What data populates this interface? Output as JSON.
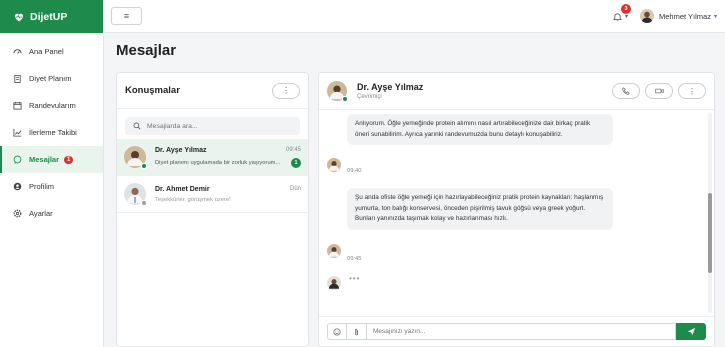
{
  "brand": {
    "name": "DijetUP"
  },
  "sidebar": {
    "items": [
      {
        "label": "Ana Panel",
        "icon": "dashboard-icon"
      },
      {
        "label": "Diyet Planım",
        "icon": "clipboard-icon"
      },
      {
        "label": "Randevularım",
        "icon": "calendar-icon"
      },
      {
        "label": "İlerleme Takibi",
        "icon": "chart-line-icon"
      },
      {
        "label": "Mesajlar",
        "icon": "chat-icon",
        "badge": "1",
        "active": true
      },
      {
        "label": "Profilim",
        "icon": "user-icon"
      },
      {
        "label": "Ayarlar",
        "icon": "gear-icon"
      }
    ]
  },
  "topbar": {
    "menu_icon": "≡",
    "notifications_count": "3",
    "user_name": "Mehmet Yılmaz"
  },
  "page": {
    "title": "Mesajlar"
  },
  "conversations": {
    "title": "Konuşmalar",
    "more_label": "⋮",
    "search_placeholder": "Mesajlarda ara...",
    "items": [
      {
        "name": "Dr. Ayşe Yılmaz",
        "time": "09:45",
        "preview": "Diyet planımı uygulamada bir zorluk yaşıyorum...",
        "unread": "1",
        "online": true
      },
      {
        "name": "Dr. Ahmet Demir",
        "time": "Dün",
        "preview": "Teşekkürler, görüşmek üzere!",
        "online": false
      }
    ]
  },
  "chat": {
    "contact_name": "Dr. Ayşe Yılmaz",
    "contact_status": "Çevrimiçi",
    "messages": [
      {
        "text": "Anlıyorum. Öğle yemeğinde protein alımını nasıl artırabileceğinize dair birkaç pratik öneri sunabilirim. Ayrıca yarınki randevumuzda bunu detaylı konuşabiliriz.",
        "time": "09:40"
      },
      {
        "text": "Şu anda ofiste öğle yemeği için hazırlayabileceğiniz pratik protein kaynakları: haşlanmış yumurta, ton balığı konservesi, önceden pişirilmiş tavuk göğsü veya greek yoğurt. Bunları yanınızda taşımak kolay ve hazırlanması hızlı.",
        "time": "09:45"
      }
    ],
    "typing_indicator": "•••",
    "composer_placeholder": "Mesajınızı yazın...",
    "accent_color": "#1e8a4c"
  }
}
